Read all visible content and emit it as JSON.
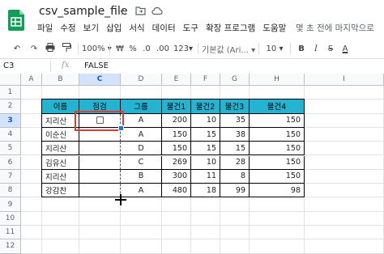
{
  "app": {
    "title": "csv_sample_file",
    "menu": [
      "파일",
      "수정",
      "보기",
      "삽입",
      "서식",
      "데이터",
      "도구",
      "확장 프로그램",
      "도움말"
    ],
    "last_edit": "몇 초 전에 마지막으로",
    "brand_color": "#0f9d58"
  },
  "toolbar": {
    "zoom": "100%",
    "currency": "₩",
    "percent": "%",
    "decimal_decrease": ".0",
    "decimal_increase": ".00",
    "more_formats": "123",
    "font": "기본값 (Ari...",
    "font_size": "10",
    "bold": "B",
    "italic": "I",
    "strike": "S",
    "text_color": "A"
  },
  "formula_bar": {
    "cell_ref": "C3",
    "fx": "fx",
    "value": "FALSE"
  },
  "grid": {
    "columns": [
      "A",
      "B",
      "C",
      "D",
      "E",
      "F",
      "G",
      "H",
      "I"
    ],
    "rows": [
      "1",
      "2",
      "3",
      "4",
      "5",
      "6",
      "7",
      "8",
      "9",
      "10",
      "11",
      "12"
    ],
    "selected_column": "C",
    "selected_row": "3",
    "header_color": "#24b3d1",
    "selection_color": "#e53935",
    "table": {
      "headers": [
        "이름",
        "점검",
        "그룹",
        "물건1",
        "물건2",
        "물건3",
        "물건4"
      ],
      "rows": [
        [
          "지리산",
          "",
          "A",
          "200",
          "10",
          "35",
          "150"
        ],
        [
          "이순신",
          "",
          "A",
          "150",
          "15",
          "38",
          "150"
        ],
        [
          "지리산",
          "",
          "D",
          "150",
          "15",
          "15",
          "150"
        ],
        [
          "김유신",
          "",
          "C",
          "269",
          "10",
          "28",
          "150"
        ],
        [
          "지리산",
          "",
          "B",
          "300",
          "11",
          "8",
          "150"
        ],
        [
          "강감찬",
          "",
          "A",
          "480",
          "18",
          "99",
          "98"
        ]
      ]
    }
  }
}
